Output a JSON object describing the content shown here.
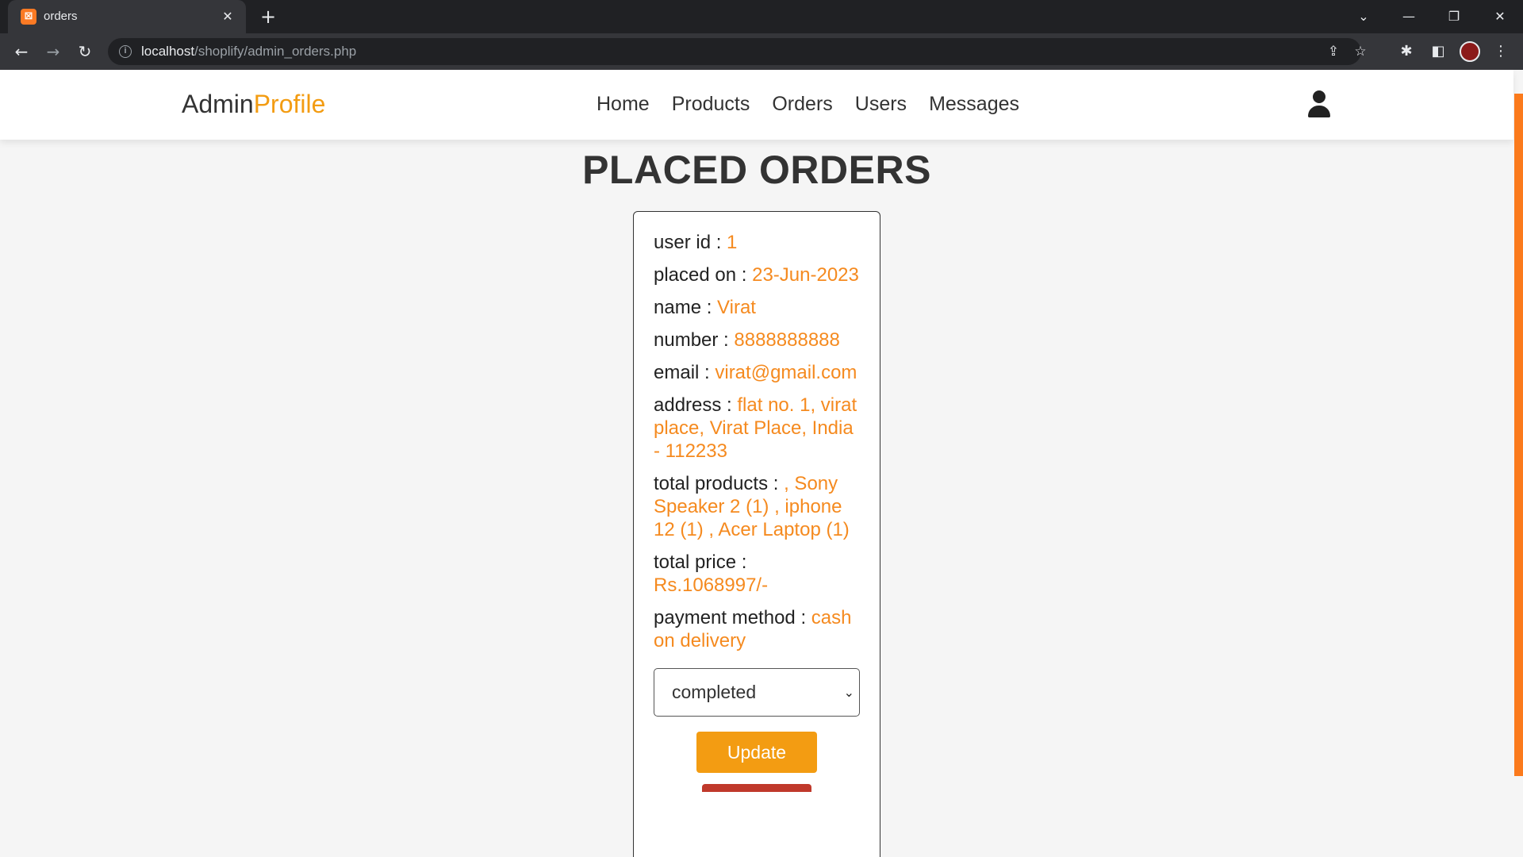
{
  "browser": {
    "tab_title": "orders",
    "url_host": "localhost",
    "url_path": "/shoplify/admin_orders.php"
  },
  "site": {
    "logo_main": "Admin",
    "logo_accent": "Profile",
    "nav": [
      "Home",
      "Products",
      "Orders",
      "Users",
      "Messages"
    ]
  },
  "page": {
    "title": "PLACED ORDERS"
  },
  "order": {
    "fields": [
      {
        "label": "user id : ",
        "value": "1"
      },
      {
        "label": "placed on : ",
        "value": "23-Jun-2023"
      },
      {
        "label": "name : ",
        "value": "Virat"
      },
      {
        "label": "number : ",
        "value": "8888888888"
      },
      {
        "label": "email : ",
        "value": "virat@gmail.com"
      },
      {
        "label": "address : ",
        "value": "flat no. 1, virat place, Virat Place, India - 112233"
      },
      {
        "label": "total products : ",
        "value": ", Sony Speaker 2 (1) , iphone 12 (1) , Acer Laptop (1)"
      },
      {
        "label": "total price : ",
        "value": "Rs.1068997/-"
      },
      {
        "label": "payment method : ",
        "value": "cash on delivery"
      }
    ],
    "status_selected": "completed",
    "update_label": "Update"
  },
  "colors": {
    "accent": "#f39c12",
    "value_text": "#f58a1f",
    "scrollbar": "#fb7a1c"
  }
}
